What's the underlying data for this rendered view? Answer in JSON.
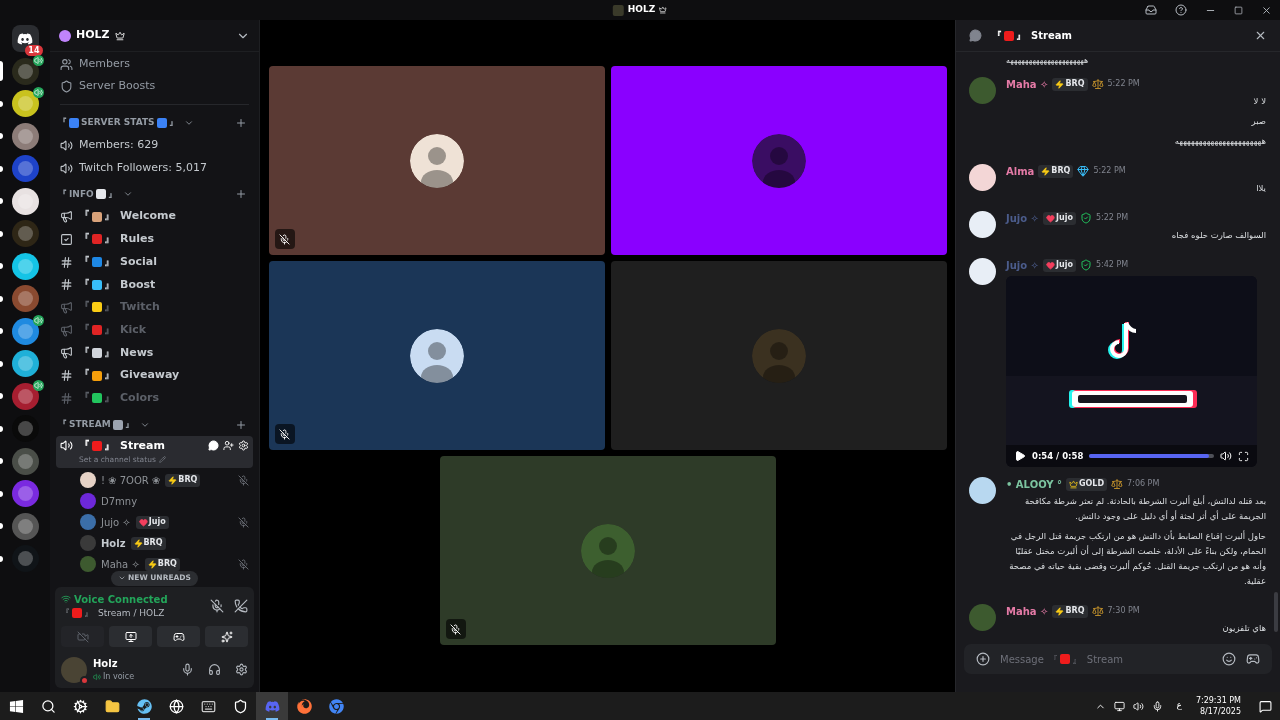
{
  "title_bar": {
    "title": "HOLZ"
  },
  "servers": [
    {
      "kind": "home",
      "color": "#2b2d31",
      "badge": "14",
      "selected": false,
      "unread": false,
      "voice": false
    },
    {
      "kind": "server",
      "color": "#2a2a1c",
      "selected": true,
      "unread": false,
      "voice": true
    },
    {
      "kind": "server",
      "color": "#c9c21e",
      "selected": false,
      "unread": true,
      "voice": true
    },
    {
      "kind": "server",
      "color": "#8c7c78",
      "selected": false,
      "unread": true,
      "voice": false
    },
    {
      "kind": "server",
      "color": "#1e43c9",
      "selected": false,
      "unread": true,
      "voice": false
    },
    {
      "kind": "server",
      "color": "#e8e2e2",
      "selected": false,
      "unread": true,
      "voice": false
    },
    {
      "kind": "server",
      "color": "#2e2616",
      "selected": false,
      "unread": true,
      "voice": false
    },
    {
      "kind": "server",
      "color": "#14c4e6",
      "selected": false,
      "unread": true,
      "voice": false
    },
    {
      "kind": "server",
      "color": "#8a4a30",
      "selected": false,
      "unread": true,
      "voice": false
    },
    {
      "kind": "server",
      "color": "#1f8ae0",
      "selected": false,
      "unread": true,
      "voice": true
    },
    {
      "kind": "server",
      "color": "#1fb0d8",
      "selected": false,
      "unread": true,
      "voice": false
    },
    {
      "kind": "server",
      "color": "#a61e30",
      "selected": false,
      "unread": true,
      "voice": true
    },
    {
      "kind": "server",
      "color": "#0a0a0a",
      "selected": false,
      "unread": true,
      "voice": false
    },
    {
      "kind": "server",
      "color": "#4a4e48",
      "selected": false,
      "unread": true,
      "voice": false
    },
    {
      "kind": "server",
      "color": "#7a2ae0",
      "selected": false,
      "unread": true,
      "voice": false
    },
    {
      "kind": "server",
      "color": "#555555",
      "selected": false,
      "unread": true,
      "voice": false
    },
    {
      "kind": "server",
      "color": "#101418",
      "selected": false,
      "unread": true,
      "voice": false
    }
  ],
  "guild": {
    "name": "HOLZ"
  },
  "nav": [
    {
      "kind": "members",
      "label": "Members"
    },
    {
      "kind": "boosts",
      "label": "Server Boosts"
    }
  ],
  "categories": [
    {
      "open": "『",
      "emoji_before": {
        "color": "#3b82f6"
      },
      "label": "SERVER STATS",
      "emoji_after": {
        "color": "#3b82f6"
      },
      "close": "』",
      "expanded": true,
      "channels": [
        {
          "kind": "stat",
          "name": "Members: 629",
          "unread": true,
          "selected": false
        },
        {
          "kind": "stat",
          "name": "Twitch Followers: 5,017",
          "unread": true,
          "selected": false
        }
      ]
    },
    {
      "open": "『",
      "label": "INFO",
      "emoji_after": {
        "color": "#e5e7eb"
      },
      "close": "』",
      "expanded": true,
      "channels": [
        {
          "kind": "announce",
          "open": "『",
          "emoji": {
            "color": "#d9a27a"
          },
          "close": "』",
          "name": "Welcome",
          "unread": true,
          "selected": false
        },
        {
          "kind": "rules",
          "open": "『",
          "emoji": {
            "color": "#e02424"
          },
          "close": "』",
          "name": "Rules",
          "unread": true,
          "selected": false
        },
        {
          "kind": "text",
          "open": "『",
          "emoji": {
            "color": "#1e88e5"
          },
          "close": "』",
          "name": "Social",
          "unread": true,
          "selected": false
        },
        {
          "kind": "text",
          "open": "『",
          "emoji": {
            "color": "#38bdf8"
          },
          "close": "』",
          "name": "Boost",
          "unread": true,
          "selected": false
        },
        {
          "kind": "announce",
          "open": "『",
          "emoji": {
            "color": "#facc15"
          },
          "close": "』",
          "name": "Twitch",
          "unread": false,
          "selected": false
        },
        {
          "kind": "announce",
          "open": "『",
          "emoji": {
            "color": "#e02424"
          },
          "close": "』",
          "name": "Kick",
          "unread": false,
          "selected": false
        },
        {
          "kind": "announce",
          "open": "『",
          "emoji": {
            "color": "#d1d5db"
          },
          "close": "』",
          "name": "News",
          "unread": true,
          "selected": false
        },
        {
          "kind": "text",
          "open": "『",
          "emoji": {
            "color": "#f59e0b"
          },
          "close": "』",
          "name": "Giveaway",
          "unread": true,
          "selected": false
        },
        {
          "kind": "text",
          "open": "『",
          "emoji": {
            "color": "#22c55e"
          },
          "close": "』",
          "name": "Colors",
          "unread": false,
          "selected": false
        }
      ]
    },
    {
      "open": "『",
      "label": "STREAM",
      "emoji_after": {
        "color": "#9ca3af"
      },
      "close": "』",
      "expanded": true,
      "channels": [
        {
          "kind": "voice",
          "open": "『",
          "emoji": {
            "color": "#ef1c1c"
          },
          "close": "』",
          "name": "Stream",
          "status": "Set a channel status",
          "unread": true,
          "selected": true
        }
      ]
    }
  ],
  "voice_members": [
    {
      "name": "! ❀ 7OOR ❀",
      "badge": {
        "kind": "bolt",
        "text": "BRQ"
      },
      "muted": true
    },
    {
      "name": "D7mny",
      "muted": false
    },
    {
      "name": "Jujo ✧",
      "badge": {
        "kind": "heart",
        "text": "Jujo"
      },
      "muted": true
    },
    {
      "name": "Holz",
      "badge": {
        "kind": "bolt",
        "text": "BRQ"
      },
      "muted": false
    },
    {
      "name": "Maha ✧",
      "badge": {
        "kind": "bolt",
        "text": "BRQ"
      },
      "muted": true
    }
  ],
  "new_unreads": "NEW UNREADS",
  "voice_panel": {
    "status": "Voice Connected",
    "open": "『",
    "emoji": {
      "color": "#ef1c1c"
    },
    "close": "』",
    "channel": "Stream / HOLZ"
  },
  "user": {
    "name": "Holz",
    "status": "In voice"
  },
  "tiles": [
    {
      "color": "#5b3a34",
      "muted": true
    },
    {
      "color": "#8a00ff",
      "muted": false
    },
    {
      "color": "#1b3657",
      "muted": true
    },
    {
      "color": "#1f1f1f",
      "muted": false
    },
    {
      "color": "#2e3b28",
      "muted": true
    }
  ],
  "chat": {
    "open": "『",
    "emoji": {
      "color": "#ef1c1c"
    },
    "title": "Stream",
    "close": "』"
  },
  "messages": [
    {
      "kind": "continuation",
      "lines": [
        "هههههههههههههههههههههه"
      ]
    },
    {
      "kind": "message",
      "author": "Maha ✧",
      "color": "#e47aa6",
      "badge": {
        "kind": "bolt",
        "text": "BRQ"
      },
      "role": {
        "kind": "scale"
      },
      "time": "5:22 PM",
      "lines": [
        "لا لا",
        "صبر",
        "ههههههههههههههههههههههه"
      ]
    },
    {
      "kind": "message",
      "author": "Alma",
      "color": "#e47aa6",
      "badge": {
        "kind": "bolt",
        "text": "BRQ"
      },
      "role": {
        "kind": "diamond"
      },
      "time": "5:22 PM",
      "lines": [
        "يلاا"
      ]
    },
    {
      "kind": "message",
      "author": "Jujo ✧",
      "color": "#4b5c8c",
      "badge": {
        "kind": "heart",
        "text": "Jujo"
      },
      "role": {
        "kind": "shield"
      },
      "time": "5:22 PM",
      "lines": [
        "السوالف صارت حلوه فجاه"
      ]
    },
    {
      "kind": "video",
      "author": "Jujo ✧",
      "color": "#4b5c8c",
      "badge": {
        "kind": "heart",
        "text": "Jujo"
      },
      "role": {
        "kind": "shield"
      },
      "time": "5:42 PM",
      "video": {
        "time": "0:54 / 0:58",
        "level": 0.96
      }
    },
    {
      "kind": "message",
      "author": "• ALOOY °",
      "color": "#7cc4a0",
      "badge": {
        "kind": "crown",
        "text": "GOLD"
      },
      "role": {
        "kind": "scale"
      },
      "time": "7:06 PM",
      "lines": [
        "بعد قتله لدالتش، أبلغ ألبرت الشرطة بالحادثة. لم تعثر شرطة مكافحة الجريمة على أي أثر لجثة أو أي دليل على وجود دالتش.",
        "حاول ألبرت إقناع الضابط بأن دالتش هو من ارتكب جريمة قتل الرجل في الحمام، ولكن بناءً على الأدلة، خلصت الشرطة إلى أن ألبرت مختل عقليًا وأنه هو من ارتكب جريمة القتل. حُوكم ألبرت وقضى بقية حياته في مصحة عقلية."
      ]
    },
    {
      "kind": "message",
      "author": "Maha ✧",
      "color": "#e47aa6",
      "badge": {
        "kind": "bolt",
        "text": "BRQ"
      },
      "role": {
        "kind": "scale"
      },
      "time": "7:30 PM",
      "lines": [
        "هاي تلفزيون"
      ]
    }
  ],
  "composer": {
    "placeholder": "Message",
    "open": "『",
    "emoji": {
      "color": "#ef1c1c"
    },
    "close": "』",
    "channel": "Stream"
  },
  "taskbar": {
    "apps": [
      {
        "kind": "start",
        "active": false
      },
      {
        "kind": "search",
        "active": false
      },
      {
        "kind": "gear",
        "active": false
      },
      {
        "kind": "folder",
        "active": false
      },
      {
        "kind": "steam",
        "active": true
      },
      {
        "kind": "g",
        "active": false
      },
      {
        "kind": "keyboard",
        "active": false
      },
      {
        "kind": "epic",
        "active": false
      },
      {
        "kind": "discord",
        "active": true
      },
      {
        "kind": "firefox",
        "active": false
      },
      {
        "kind": "chrome",
        "active": false
      }
    ],
    "language": "ع",
    "time": "7:29:31 PM",
    "date": "8/17/2025"
  }
}
